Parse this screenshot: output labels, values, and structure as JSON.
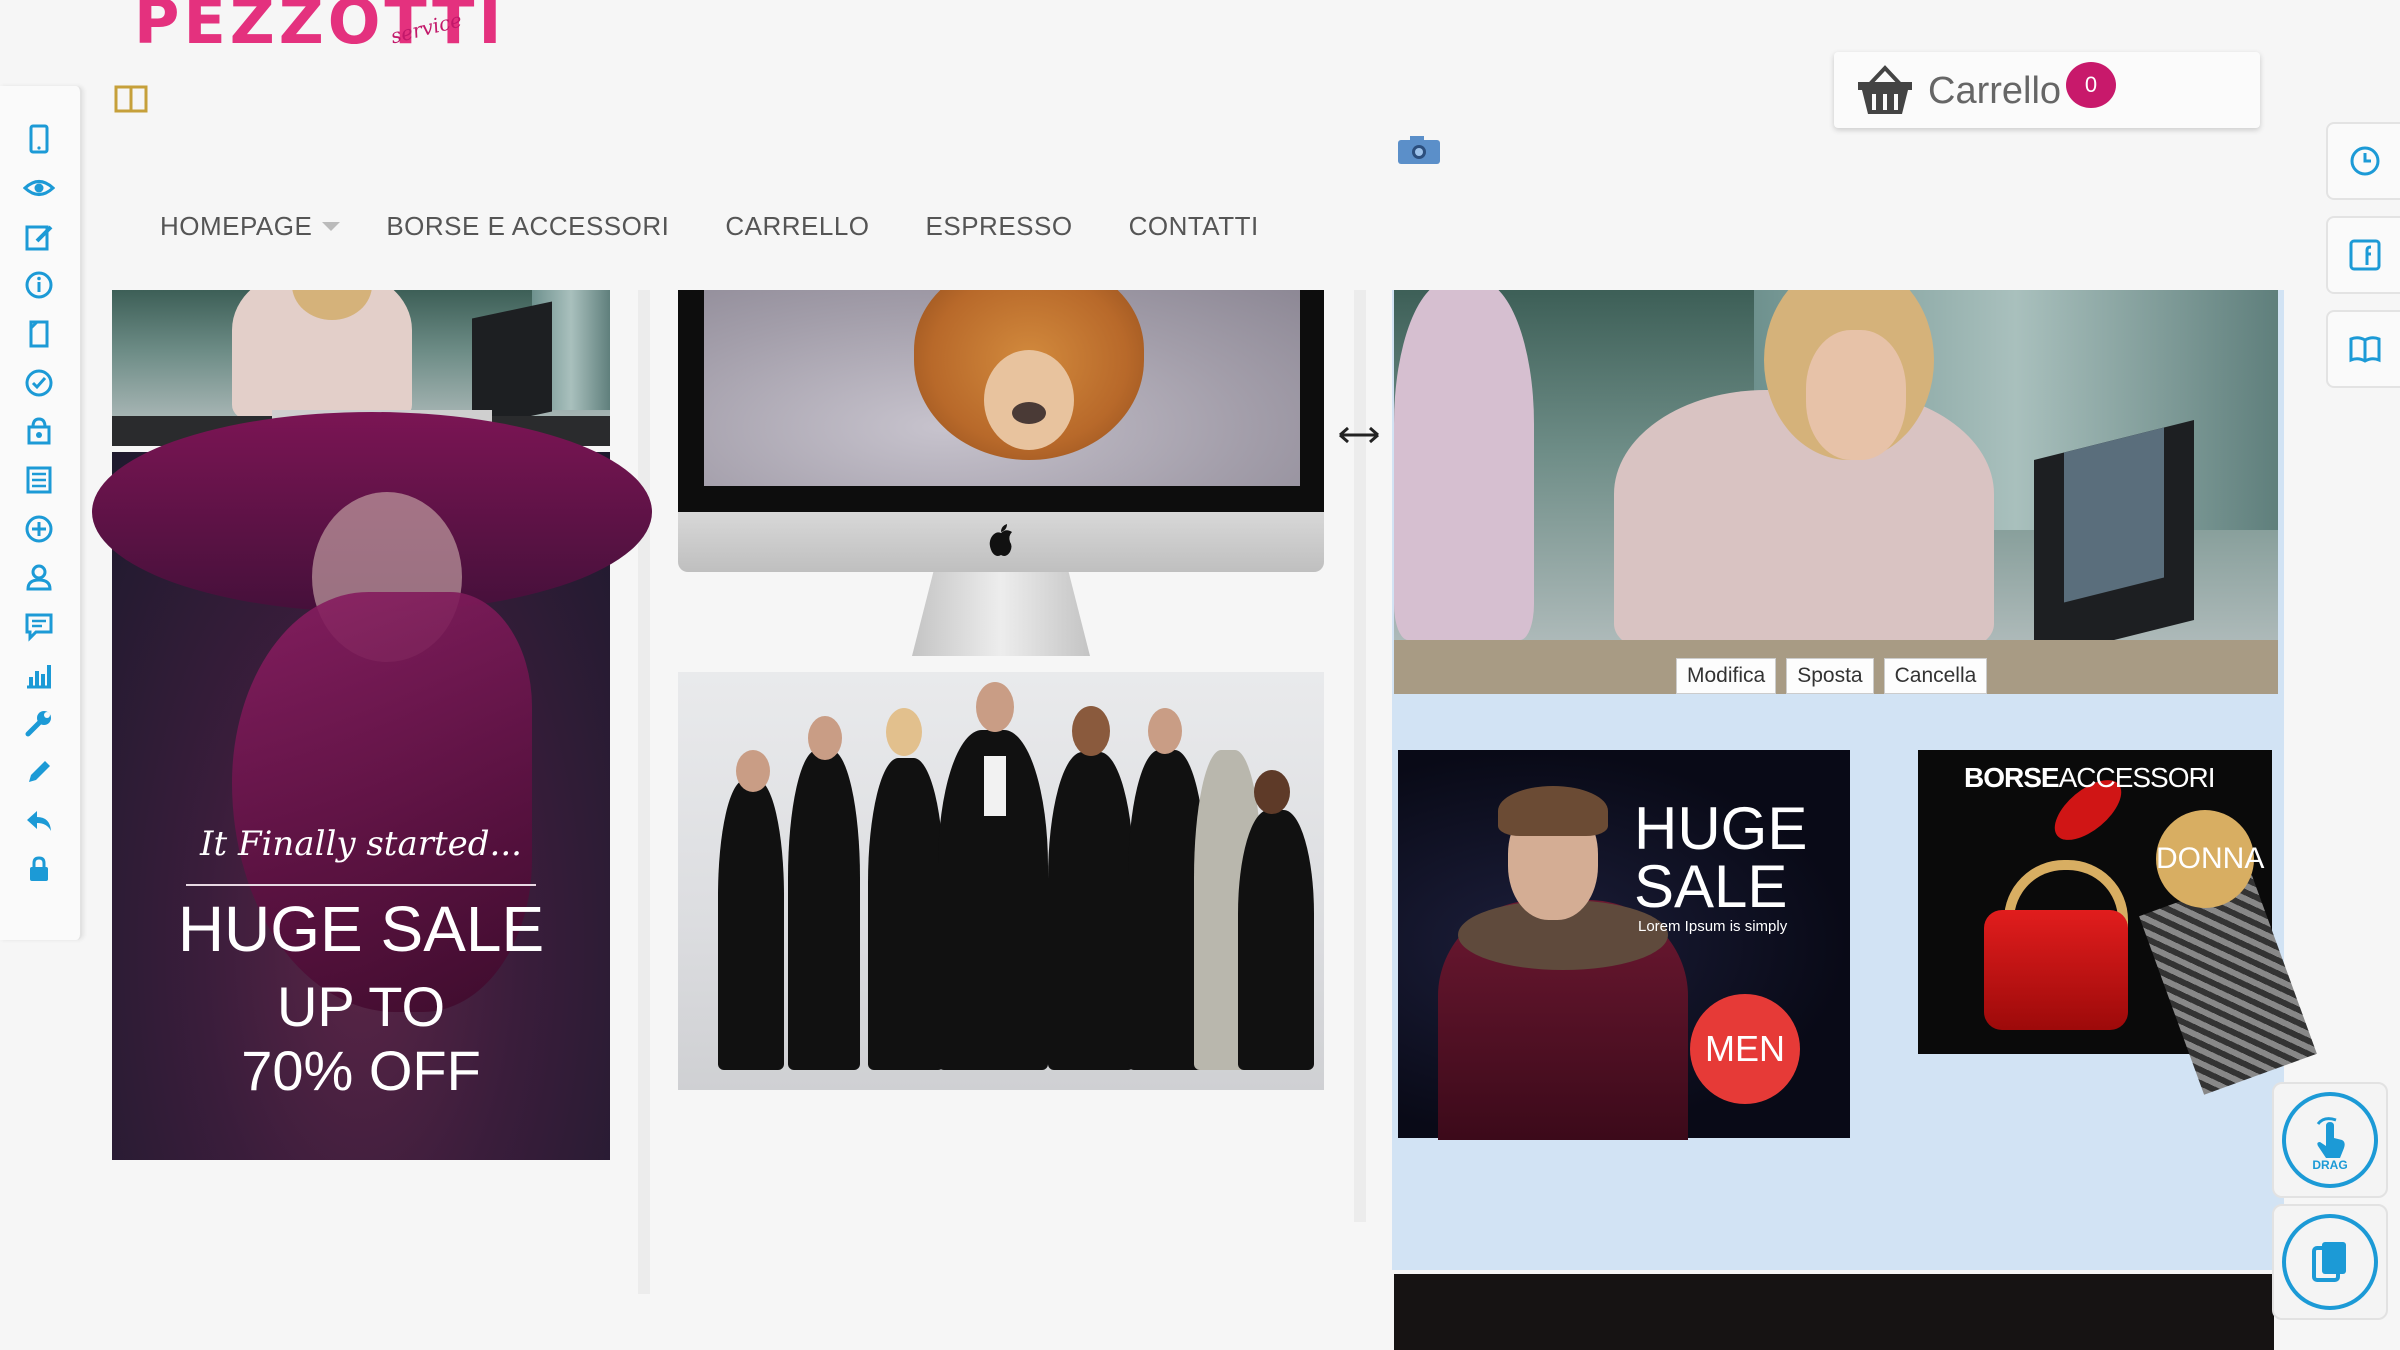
{
  "logo": {
    "name": "PEZZOTTI",
    "tagline": "service"
  },
  "colors": {
    "brand": "#e4317e",
    "accent": "#1c9ad6",
    "badge": "#c8196b"
  },
  "left_toolbar": [
    {
      "icon": "tablet-icon"
    },
    {
      "icon": "eye-icon"
    },
    {
      "icon": "edit-icon"
    },
    {
      "icon": "info-icon"
    },
    {
      "icon": "page-icon"
    },
    {
      "icon": "check-circle-icon"
    },
    {
      "icon": "shop-icon"
    },
    {
      "icon": "list-icon"
    },
    {
      "icon": "add-circle-icon"
    },
    {
      "icon": "user-icon"
    },
    {
      "icon": "comment-icon"
    },
    {
      "icon": "chart-icon"
    },
    {
      "icon": "wrench-icon"
    },
    {
      "icon": "pencil-icon"
    },
    {
      "icon": "reply-icon"
    },
    {
      "icon": "lock-icon"
    }
  ],
  "cart": {
    "label": "Carrello",
    "count": "0"
  },
  "nav": {
    "items": [
      {
        "label": "HOMEPAGE",
        "has_dropdown": true
      },
      {
        "label": "BORSE E ACCESSORI"
      },
      {
        "label": "CARRELLO"
      },
      {
        "label": "ESPRESSO"
      },
      {
        "label": "CONTATTI"
      }
    ]
  },
  "right_toolbar": [
    {
      "icon": "clock-icon"
    },
    {
      "icon": "facebook-icon"
    },
    {
      "icon": "book-icon"
    }
  ],
  "dress_banner": {
    "script": "It Finally started...",
    "headline": "HUGE SALE",
    "line2": "UP TO",
    "line3": "70% OFF"
  },
  "edit_bar": {
    "edit": "Modifica",
    "move": "Sposta",
    "delete": "Cancella"
  },
  "men_banner": {
    "headline_1": "HUGE",
    "headline_2": "SALE",
    "sub": "Lorem Ipsum is simply",
    "badge": "MEN"
  },
  "bag_banner": {
    "title_bold": "BORSE",
    "title_light": "ACCESSORI",
    "badge": "DONNA"
  },
  "floating": {
    "drag_label": "DRAG"
  }
}
